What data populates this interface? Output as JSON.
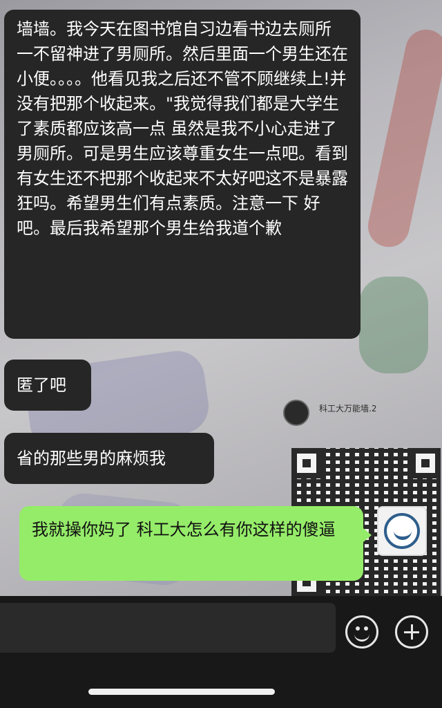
{
  "messages": [
    {
      "side": "received",
      "text": "墙墙。我今天在图书馆自习边看书边去厕所 一不留神进了男厕所。然后里面一个男生还在小便。。。。他看见我之后还不管不顾继续上!并没有把那个收起来。\"我觉得我们都是大学生了素质都应该高一点 虽然是我不小心走进了男厕所。可是男生应该尊重女生一点吧。看到有女生还不把那个收起来不太好吧这不是暴露狂吗。希望男生们有点素质。注意一下 好吧。最后我希望那个男生给我道个歉"
    },
    {
      "side": "received",
      "text": "匿了吧"
    },
    {
      "side": "received",
      "text": "省的那些男的麻烦我"
    },
    {
      "side": "sent",
      "text": "我就操你妈了 科工大怎么有你这样的傻逼"
    }
  ],
  "wallpaper": {
    "account_name": "科工大万能墙.2"
  },
  "input_bar": {
    "placeholder": "",
    "emoji_icon": "smiley-icon",
    "plus_icon": "plus-circle-icon"
  },
  "colors": {
    "received_bubble": "#262626",
    "sent_bubble": "#95ec69"
  }
}
